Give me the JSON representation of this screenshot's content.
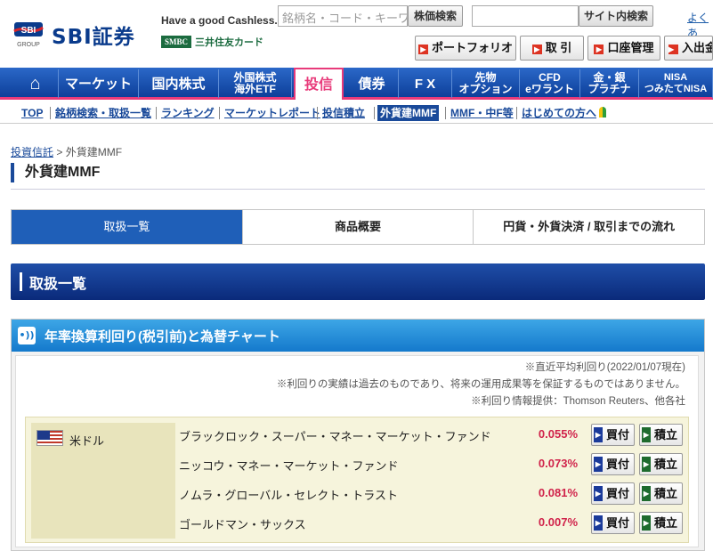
{
  "brand": {
    "logo_mark": "SBI",
    "logo_sub": "GROUP",
    "logo_text": "SBI証券",
    "tagline": "Have a good Cashless.",
    "partner_box": "SMBC",
    "partner_name": "三井住友カード"
  },
  "search": {
    "stock_placeholder": "銘柄名・コード・キーワード",
    "stock_button": "株価検索",
    "site_placeholder": "",
    "site_button": "サイト内検索",
    "help_link": "よくあ"
  },
  "quick_links": [
    {
      "label": "ポートフォリオ"
    },
    {
      "label": "取 引"
    },
    {
      "label": "口座管理"
    },
    {
      "label": "入出金"
    }
  ],
  "main_nav": [
    {
      "label": "⌂",
      "icon": "home-icon"
    },
    {
      "label": "マーケット"
    },
    {
      "label": "国内株式"
    },
    {
      "label": "外国株式\n海外ETF"
    },
    {
      "label": "投信",
      "active": true
    },
    {
      "label": "債券"
    },
    {
      "label": "F X"
    },
    {
      "label": "先物\nオプション"
    },
    {
      "label": "CFD\neワラント"
    },
    {
      "label": "金・銀\nプラチナ"
    },
    {
      "label": "NISA\nつみたてNISA"
    }
  ],
  "sub_nav": [
    {
      "label": "TOP"
    },
    {
      "label": "銘柄検索・取扱一覧"
    },
    {
      "label": "ランキング"
    },
    {
      "label": "マーケットレポート"
    },
    {
      "label": "投信積立"
    },
    {
      "label": "外貨建MMF",
      "active": true
    },
    {
      "label": "MMF・中F等"
    },
    {
      "label": "はじめての方へ"
    }
  ],
  "breadcrumb": {
    "parent": "投資信託",
    "sep": " > ",
    "current": "外貨建MMF"
  },
  "page_title": "外貨建MMF",
  "tabs": [
    {
      "label": "取扱一覧",
      "active": true
    },
    {
      "label": "商品概要"
    },
    {
      "label": "円貨・外貨決済 / 取引までの流れ"
    }
  ],
  "section_title": "取扱一覧",
  "panel": {
    "title": "年率換算利回り(税引前)と為替チャート",
    "icon_glyph": "•))",
    "notes": [
      "※直近平均利回り(2022/01/07現在)",
      "※利回りの実績は過去のものであり、将来の運用成果等を保証するものではありません。",
      "※利回り情報提供：Thomson Reuters、他各社"
    ]
  },
  "currency": {
    "name": "米ドル",
    "flag": "us-flag-icon",
    "funds": [
      {
        "name": "ブラックロック・スーパー・マネー・マーケット・ファンド",
        "yield": "0.055%"
      },
      {
        "name": "ニッコウ・マネー・マーケット・ファンド",
        "yield": "0.073%"
      },
      {
        "name": "ノムラ・グローバル・セレクト・トラスト",
        "yield": "0.081%"
      },
      {
        "name": "ゴールドマン・サックス",
        "yield": "0.007%"
      }
    ],
    "buy_label": "買付",
    "accumulate_label": "積立"
  },
  "colors": {
    "brand_blue": "#0a3b8c",
    "nav_blue": "#1f5fb8",
    "active_pink": "#e83a7a",
    "yield_red": "#d0224a",
    "panel_blue": "#1479cc"
  }
}
